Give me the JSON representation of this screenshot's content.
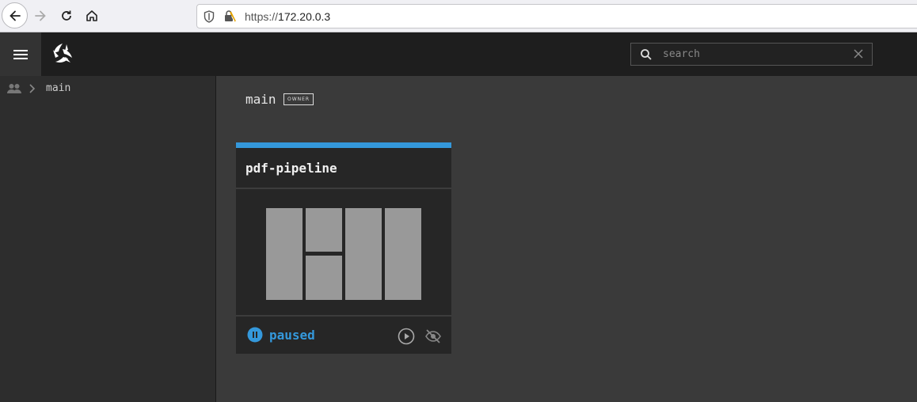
{
  "browser": {
    "url_protocol": "https://",
    "url_host": "172.20.0.3"
  },
  "header": {
    "search_placeholder": "search"
  },
  "sidebar": {
    "breadcrumb_team": "main"
  },
  "main": {
    "team_name": "main",
    "role_badge": "OWNER"
  },
  "pipelines": [
    {
      "name": "pdf-pipeline",
      "status": "paused",
      "accent_color": "#3498db"
    }
  ],
  "icons": {
    "back": "arrow-left-icon",
    "forward": "arrow-right-icon",
    "reload": "reload-icon",
    "home": "home-icon",
    "menu": "hamburger-icon",
    "search": "search-icon",
    "clear": "close-icon",
    "team": "people-icon",
    "chevron": "chevron-right-icon",
    "pause": "pause-circle-icon",
    "play": "play-circle-icon",
    "hide": "eye-off-icon"
  }
}
